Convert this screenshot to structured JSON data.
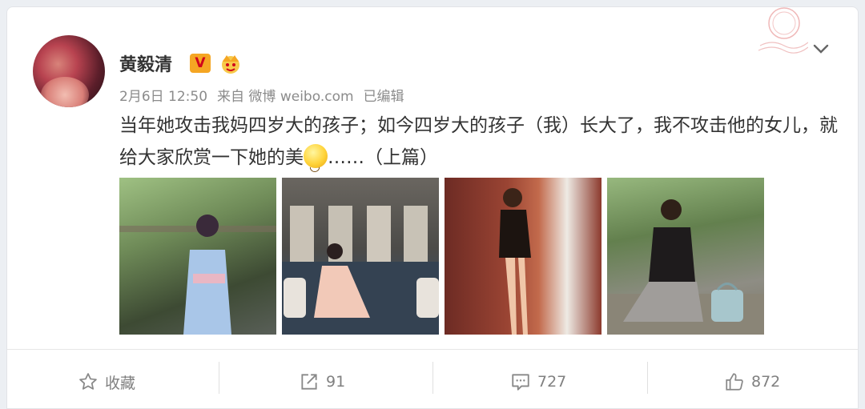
{
  "post": {
    "author": "黄毅清",
    "verified_badge": "V",
    "date": "2月6日 12:50",
    "source": "来自 微博 weibo.com",
    "edited": "已编辑",
    "text_before_emoji": "当年她攻击我妈四岁大的孩子；如今四岁大的孩子（我）长大了，我不攻击他的女儿，就给大家欣赏一下她的美",
    "text_after_emoji": "……（上篇）",
    "photos": [
      "photo-1",
      "photo-2",
      "photo-3",
      "photo-4"
    ]
  },
  "actions": {
    "favorite_label": "收藏",
    "repost_count": "91",
    "comment_count": "727",
    "like_count": "872"
  },
  "icons": [
    "crown-icon",
    "chevron-down-icon",
    "star-icon",
    "repost-icon",
    "comment-icon",
    "like-icon",
    "smile-emoji-icon"
  ],
  "colors": {
    "badge": "#f5a623",
    "text": "#333333",
    "meta": "#8b8b8b"
  }
}
